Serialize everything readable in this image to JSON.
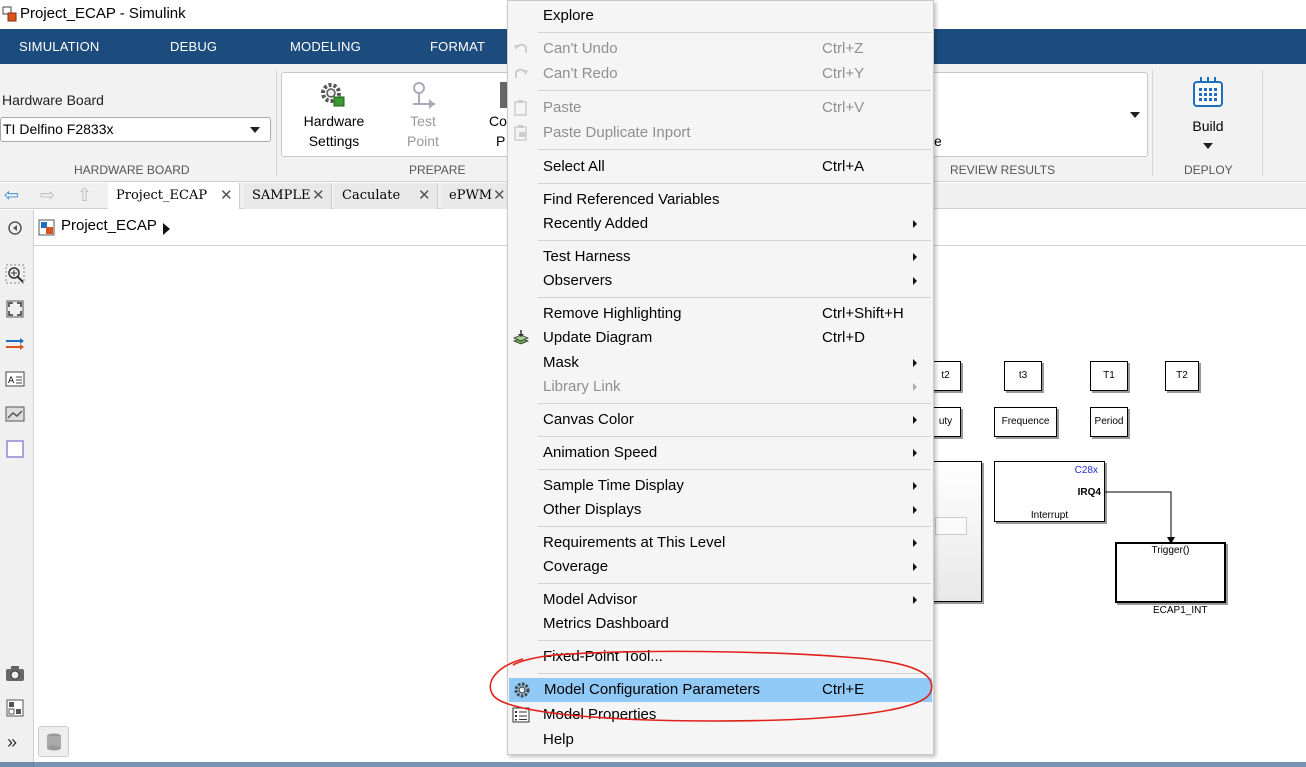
{
  "window": {
    "title": "Project_ECAP - Simulink"
  },
  "ribbon_tabs": [
    "SIMULATION",
    "DEBUG",
    "MODELING",
    "FORMAT"
  ],
  "ribbon": {
    "hardware_board_label": "Hardware Board",
    "hardware_board_value": "TI Delfino F2833x",
    "hardware_settings_line1": "Hardware",
    "hardware_settings_line2": "Settings",
    "test_point_line1": "Test",
    "test_point_line2": "Point",
    "partial_button_line1": "Co",
    "partial_button_line2": "P",
    "review_partial": "e",
    "build_label": "Build",
    "sections": {
      "hardware_board": "HARDWARE BOARD",
      "prepare": "PREPARE",
      "review_results": "REVIEW RESULTS",
      "deploy": "DEPLOY"
    }
  },
  "doc_tabs": [
    {
      "label": "Project_ECAP",
      "active": true
    },
    {
      "label": "SAMPLE",
      "active": false
    },
    {
      "label": "Caculate",
      "active": false
    },
    {
      "label": "ePWM",
      "active": false
    }
  ],
  "breadcrumb": {
    "model": "Project_ECAP"
  },
  "canvas_blocks": {
    "t2": "t2",
    "t3": "t3",
    "T1": "T1",
    "T2": "T2",
    "duty": "uty",
    "frequence": "Frequence",
    "period": "Period",
    "c28x": "C28x",
    "irq": "IRQ4",
    "interrupt": "Interrupt",
    "trigger": "Trigger()",
    "ecap1_int": "ECAP1_INT"
  },
  "context_menu": {
    "items": [
      {
        "label": "Explore",
        "shortcut": "",
        "submenu": false,
        "disabled": false
      },
      {
        "label": "Can't Undo",
        "shortcut": "Ctrl+Z",
        "submenu": false,
        "disabled": true,
        "icon": "undo-icon"
      },
      {
        "label": "Can't Redo",
        "shortcut": "Ctrl+Y",
        "submenu": false,
        "disabled": true,
        "icon": "redo-icon"
      },
      {
        "label": "Paste",
        "shortcut": "Ctrl+V",
        "submenu": false,
        "disabled": true,
        "icon": "paste-icon"
      },
      {
        "label": "Paste Duplicate Inport",
        "shortcut": "",
        "submenu": false,
        "disabled": true,
        "icon": "paste-duplicate-icon"
      },
      {
        "label": "Select All",
        "shortcut": "Ctrl+A",
        "submenu": false,
        "disabled": false
      },
      {
        "label": "Find Referenced Variables",
        "shortcut": "",
        "submenu": false,
        "disabled": false
      },
      {
        "label": "Recently Added",
        "shortcut": "",
        "submenu": true,
        "disabled": false
      },
      {
        "label": "Test Harness",
        "shortcut": "",
        "submenu": true,
        "disabled": false
      },
      {
        "label": "Observers",
        "shortcut": "",
        "submenu": true,
        "disabled": false
      },
      {
        "label": "Remove Highlighting",
        "shortcut": "Ctrl+Shift+H",
        "submenu": false,
        "disabled": false
      },
      {
        "label": "Update Diagram",
        "shortcut": "Ctrl+D",
        "submenu": false,
        "disabled": false,
        "icon": "update-diagram-icon"
      },
      {
        "label": "Mask",
        "shortcut": "",
        "submenu": true,
        "disabled": false
      },
      {
        "label": "Library Link",
        "shortcut": "",
        "submenu": true,
        "disabled": true
      },
      {
        "label": "Canvas Color",
        "shortcut": "",
        "submenu": true,
        "disabled": false
      },
      {
        "label": "Animation Speed",
        "shortcut": "",
        "submenu": true,
        "disabled": false
      },
      {
        "label": "Sample Time Display",
        "shortcut": "",
        "submenu": true,
        "disabled": false
      },
      {
        "label": "Other Displays",
        "shortcut": "",
        "submenu": true,
        "disabled": false
      },
      {
        "label": "Requirements at This Level",
        "shortcut": "",
        "submenu": true,
        "disabled": false
      },
      {
        "label": "Coverage",
        "shortcut": "",
        "submenu": true,
        "disabled": false
      },
      {
        "label": "Model Advisor",
        "shortcut": "",
        "submenu": true,
        "disabled": false
      },
      {
        "label": "Metrics Dashboard",
        "shortcut": "",
        "submenu": false,
        "disabled": false
      },
      {
        "label": "Fixed-Point Tool...",
        "shortcut": "",
        "submenu": false,
        "disabled": false
      },
      {
        "label": "Model Configuration Parameters",
        "shortcut": "Ctrl+E",
        "submenu": false,
        "disabled": false,
        "highlighted": true,
        "icon": "gear-icon"
      },
      {
        "label": "Model Properties",
        "shortcut": "",
        "submenu": false,
        "disabled": false,
        "icon": "properties-icon"
      },
      {
        "label": "Help",
        "shortcut": "",
        "submenu": false,
        "disabled": false
      }
    ]
  },
  "colors": {
    "ribbon_tab_bar": "#1c4b7e",
    "menu_highlight": "#91c9f7",
    "annotation_circle": "#e0201b",
    "disabled_text": "#8f8f8f"
  }
}
